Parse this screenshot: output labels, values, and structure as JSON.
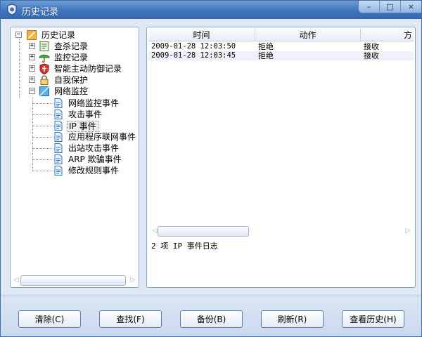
{
  "window": {
    "title": "历史记录"
  },
  "controls": {
    "minimize": "–",
    "maximize": "□",
    "close": "×"
  },
  "tree": {
    "root": "历史记录",
    "items": [
      {
        "label": "查杀记录",
        "icon": "scan-log-icon"
      },
      {
        "label": "监控记录",
        "icon": "monitor-umbrella-icon"
      },
      {
        "label": "智能主动防御记录",
        "icon": "shield-icon"
      },
      {
        "label": "自我保护",
        "icon": "lock-icon"
      },
      {
        "label": "网络监控",
        "icon": "network-monitor-icon"
      }
    ],
    "network_children": [
      {
        "label": "网络监控事件"
      },
      {
        "label": "攻击事件"
      },
      {
        "label": "IP 事件"
      },
      {
        "label": "应用程序联网事件"
      },
      {
        "label": "出站攻击事件"
      },
      {
        "label": "ARP 欺骗事件"
      },
      {
        "label": "修改规则事件"
      }
    ]
  },
  "table": {
    "columns": [
      "时间",
      "动作",
      "方"
    ],
    "rows": [
      {
        "time": "2009-01-28 12:03:50",
        "action": "拒绝",
        "direction": "接收"
      },
      {
        "time": "2009-01-28 12:03:45",
        "action": "拒绝",
        "direction": "接收"
      }
    ]
  },
  "status": "2 项 IP 事件日志",
  "buttons": {
    "clear": "清除(C)",
    "find": "查找(F)",
    "backup": "备份(B)",
    "refresh": "刷新(R)",
    "history": "查看历史(H)"
  },
  "colors": {
    "titlebar": "#3f74bd",
    "panel_border": "#8aa6cc",
    "background": "#dfe8f5"
  }
}
